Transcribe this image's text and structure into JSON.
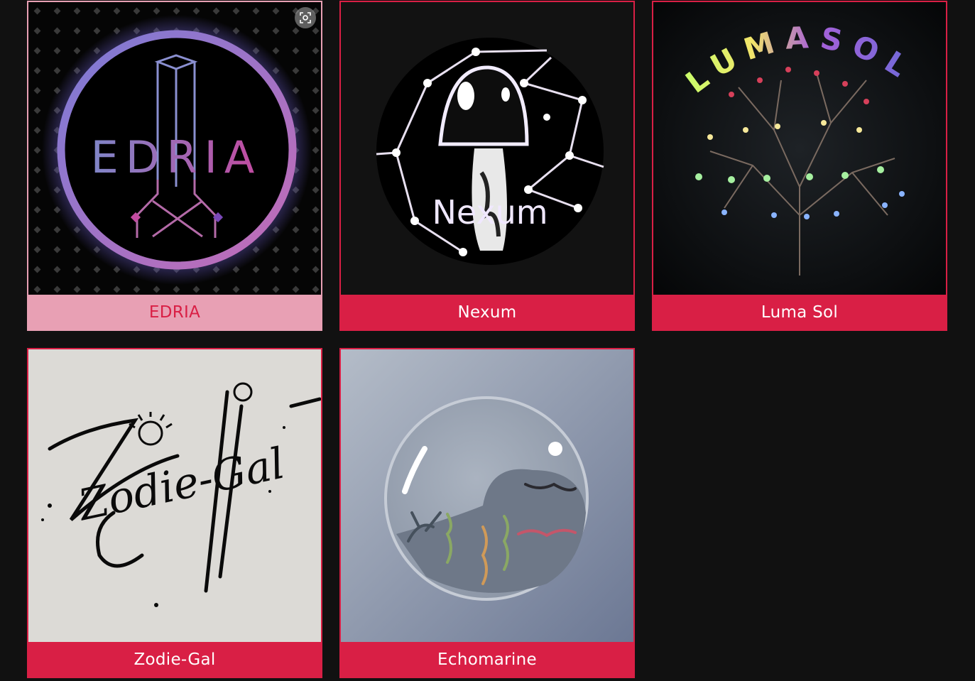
{
  "projects": [
    {
      "title": "EDRIA",
      "logo_text": "EDRIA",
      "hovered": true
    },
    {
      "title": "Nexum",
      "logo_text": "Nexum"
    },
    {
      "title": "Luma Sol",
      "logo_text": "LUMASOL"
    },
    {
      "title": "Zodie-Gal",
      "logo_text": "Zodie-Gal"
    },
    {
      "title": "Echomarine"
    }
  ],
  "icons": {
    "expand": "expand-icon"
  },
  "colors": {
    "page_background": "#111111",
    "caption_background": "#d91f45",
    "caption_hover_background": "#e8a0b4",
    "caption_text": "#ffffff",
    "caption_hover_text": "#d91f45"
  }
}
